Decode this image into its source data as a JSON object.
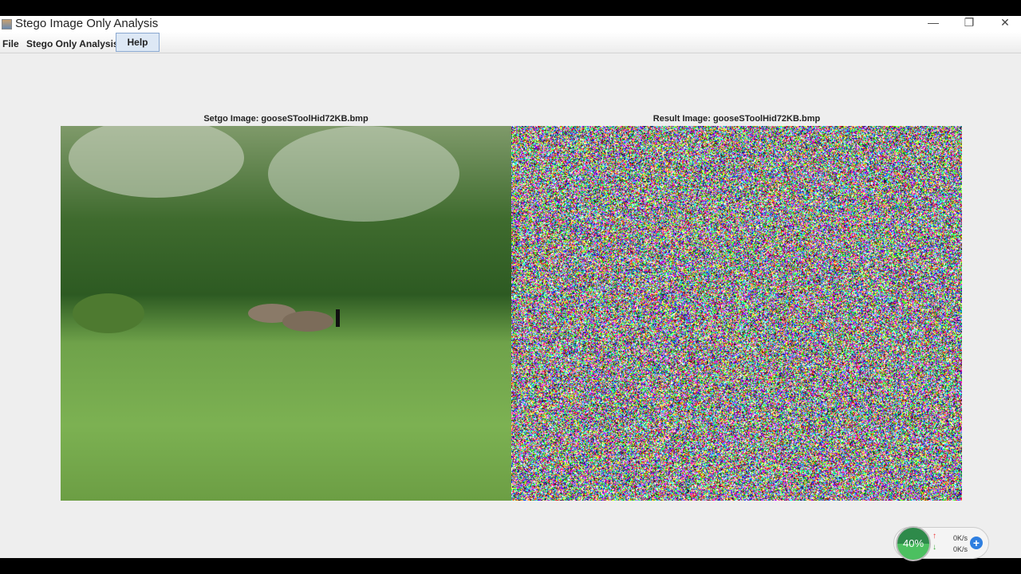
{
  "window": {
    "title": "Stego Image Only Analysis",
    "minimize": "—",
    "restore": "❐",
    "close": "✕"
  },
  "menu": {
    "file": "File",
    "stego": "Stego Only Analysis",
    "help": "Help"
  },
  "captions": {
    "stego": "Setgo Image: gooseSToolHid72KB.bmp",
    "result": "Result Image: gooseSToolHid72KB.bmp"
  },
  "tray": {
    "percent": "40%",
    "up": "0K/s",
    "down": "0K/s",
    "up_arrow": "↑",
    "down_arrow": "↓",
    "plus": "+"
  }
}
